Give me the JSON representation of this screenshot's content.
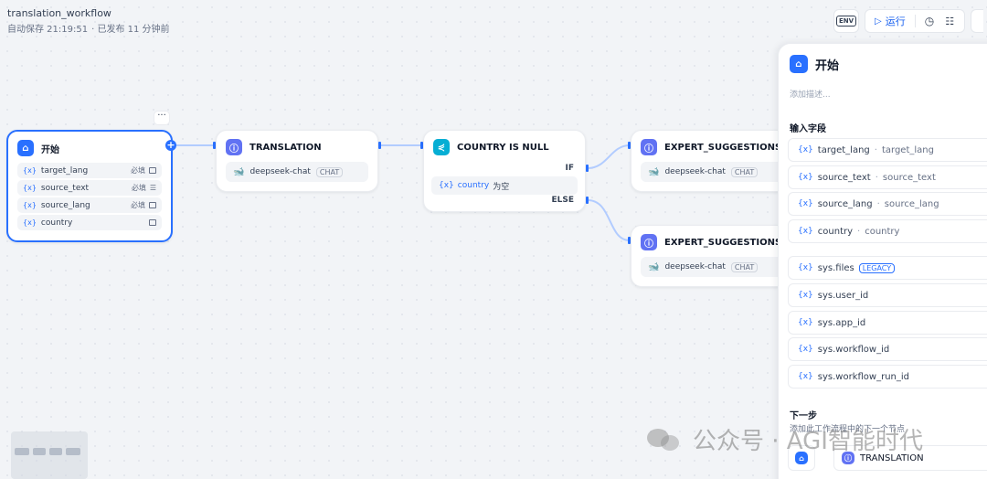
{
  "app": {
    "title": "translation_workflow",
    "autosave": "自动保存 21:19:51",
    "published": "· 已发布 11 分钟前"
  },
  "toolbar": {
    "env_label": "ENV",
    "run_label": "运行",
    "accent_color": "#155eef"
  },
  "nodes": {
    "start": {
      "title": "开始",
      "vars": [
        {
          "name": "target_lang",
          "required": "必填",
          "icon": "select-icon"
        },
        {
          "name": "source_text",
          "required": "必填",
          "icon": "paragraph-icon"
        },
        {
          "name": "source_lang",
          "required": "必填",
          "icon": "select-icon"
        },
        {
          "name": "country",
          "required": "",
          "icon": "select-icon"
        }
      ]
    },
    "translation": {
      "title": "TRANSLATION",
      "model": "deepseek-chat",
      "mode": "CHAT"
    },
    "country_null": {
      "title": "COUNTRY IS NULL",
      "if_label": "IF",
      "cond_var": "country",
      "cond_op": "为空",
      "else_label": "ELSE"
    },
    "expert1": {
      "title": "EXPERT_SUGGESTIONS",
      "model": "deepseek-chat",
      "mode": "CHAT"
    },
    "expert2": {
      "title": "EXPERT_SUGGESTIONS_W",
      "model": "deepseek-chat",
      "mode": "CHAT"
    }
  },
  "panel": {
    "title": "开始",
    "description_placeholder": "添加描述...",
    "input_fields_label": "输入字段",
    "fields": [
      {
        "name": "target_lang",
        "alias": "target_lang"
      },
      {
        "name": "source_text",
        "alias": "source_text"
      },
      {
        "name": "source_lang",
        "alias": "source_lang"
      },
      {
        "name": "country",
        "alias": "country"
      }
    ],
    "sys_fields": [
      {
        "name": "sys.files",
        "badge": "LEGACY"
      },
      {
        "name": "sys.user_id"
      },
      {
        "name": "sys.app_id"
      },
      {
        "name": "sys.workflow_id"
      },
      {
        "name": "sys.workflow_run_id"
      }
    ],
    "next_step_label": "下一步",
    "next_step_desc": "添加此工作流程中的下一个节点",
    "next_node": "TRANSLATION"
  },
  "watermark": {
    "text": "公众号 · AGI智能时代"
  }
}
